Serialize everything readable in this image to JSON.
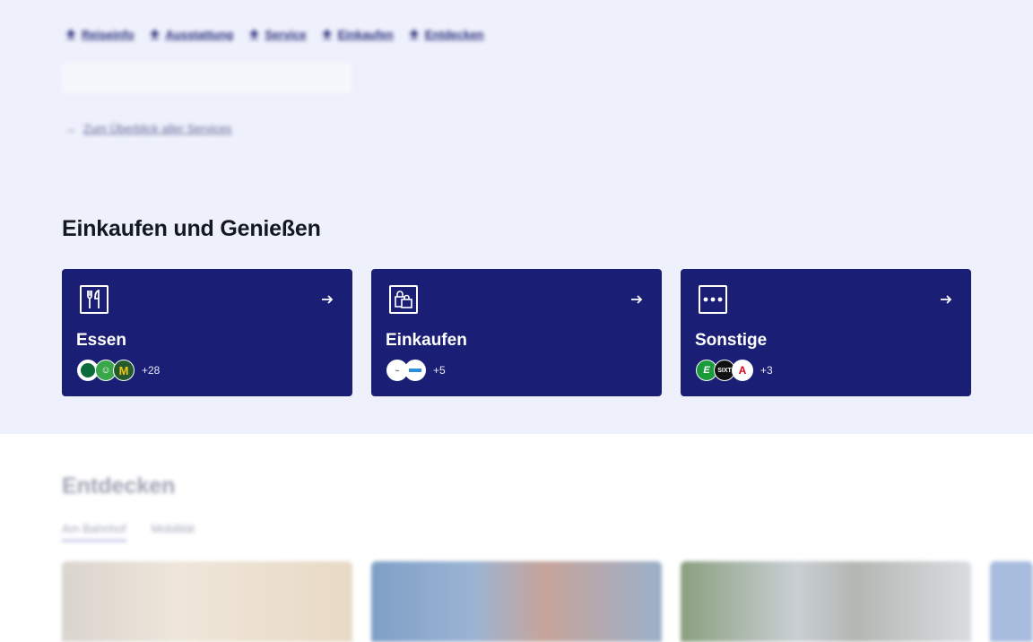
{
  "nav": {
    "items": [
      "Reiseinfo",
      "Ausstattung",
      "Service",
      "Einkaufen",
      "Entdecken"
    ]
  },
  "overview_link": "Zum Überblick aller Services",
  "section_title": "Einkaufen und Genießen",
  "cards": [
    {
      "title": "Essen",
      "icon": "cutlery-icon",
      "logos": [
        "starbucks",
        "green-chef",
        "mcdonalds"
      ],
      "more": "+28"
    },
    {
      "title": "Einkaufen",
      "icon": "shopping-bags-icon",
      "logos": [
        "brand-a",
        "brand-b"
      ],
      "more": "+5"
    },
    {
      "title": "Sonstige",
      "icon": "dots-icon",
      "logos": [
        "E",
        "SIXT",
        "pharmacy-A"
      ],
      "more": "+3"
    }
  ],
  "discover": {
    "title": "Entdecken",
    "tabs": [
      "Am Bahnhof",
      "Mobilität"
    ],
    "active_tab": "Am Bahnhof"
  },
  "colors": {
    "top_bg": "#eef0fc",
    "card_bg": "#1a1f75",
    "text_dark": "#131821"
  }
}
